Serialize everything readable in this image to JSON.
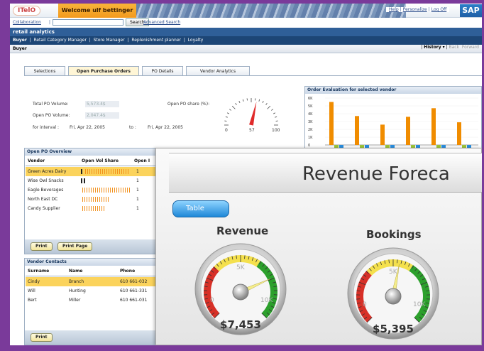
{
  "header": {
    "logo": "ITelO",
    "welcome": "Welcome ulf bettinger",
    "links": [
      "Help",
      "Personalize",
      "Log Off"
    ],
    "brand": "SAP"
  },
  "search": {
    "collaboration": "Collaboration",
    "button": "Search",
    "advanced": "Advanced Search",
    "value": ""
  },
  "app_title": "retail analytics",
  "nav": {
    "items": [
      "Buyer",
      "Retail Category Manager",
      "Store Manager",
      "Replenishment planner",
      "Loyalty"
    ]
  },
  "page": {
    "title": "Buyer",
    "history": "History",
    "back": "Back",
    "forward": "Forward"
  },
  "tabs": [
    "Selections",
    "Open Purchase Orders",
    "PO Details",
    "Vendor Analytics"
  ],
  "po": {
    "total_label": "Total PO Volume:",
    "total_value": "5,573.4$",
    "open_label": "Open PO Volume:",
    "open_value": "2,047.4$",
    "interval_label": "for interval :",
    "from": "Fri, Apr 22, 2005",
    "to_label": "to :",
    "to": "Fri, Apr 22, 2005",
    "share_label": "Open PO share (%):",
    "gauge_min": "0",
    "gauge_mid": "57",
    "gauge_max": "100",
    "share_value": 57
  },
  "order_eval": {
    "title": "Order Evaluation for selected vendor",
    "yticks": [
      "6K",
      "5K",
      "4K",
      "3K",
      "2K",
      "1K",
      "0"
    ]
  },
  "chart_data": {
    "type": "bar",
    "title": "Order Evaluation for selected vendor",
    "ylim": [
      0,
      6000
    ],
    "series": [
      {
        "values": [
          5500,
          3700,
          2600,
          3600,
          4700,
          2900
        ]
      },
      {
        "values": [
          -500,
          -500,
          -500,
          -500,
          -500,
          -500
        ]
      },
      {
        "values": [
          -700,
          -700,
          -700,
          -700,
          -700,
          -700
        ]
      }
    ]
  },
  "overview": {
    "title": "Open PO Overview",
    "columns": [
      "Vendor",
      "Open Vol Share",
      "Open I"
    ],
    "rows": [
      {
        "vendor": "Green Acres Dairy",
        "share": 0.9,
        "dark": 0.05,
        "count": "1"
      },
      {
        "vendor": "Wise Owl Snacks",
        "share": 0.0,
        "dark": 0.12,
        "count": "1"
      },
      {
        "vendor": "Eagle Beverages",
        "share": 0.95,
        "dark": 0.0,
        "count": "1"
      },
      {
        "vendor": "North East DC",
        "share": 0.55,
        "dark": 0.0,
        "count": "1"
      },
      {
        "vendor": "Candy Supplier",
        "share": 0.45,
        "dark": 0.0,
        "count": "1"
      }
    ],
    "print": "Print",
    "print_page": "Print Page"
  },
  "contacts": {
    "title": "Vendor Contacts",
    "columns": [
      "Surname",
      "Name",
      "Phone"
    ],
    "rows": [
      {
        "surname": "Cindy",
        "name": "Branch",
        "phone": "610 661-032"
      },
      {
        "surname": "Will",
        "name": "Hunting",
        "phone": "610 661-331"
      },
      {
        "surname": "Bert",
        "name": "Miller",
        "phone": "610 661-031"
      }
    ],
    "print": "Print"
  },
  "dashboard": {
    "title": "Revenue Foreca",
    "table_button": "Table",
    "revenue": {
      "title": "Revenue",
      "value": "$7,453",
      "min": "0",
      "mid": "5K",
      "max": "10K",
      "level": 0.745
    },
    "bookings": {
      "title": "Bookings",
      "value": "$5,395",
      "min": "0",
      "mid": "5K",
      "max": "10K",
      "level": 0.54
    }
  }
}
